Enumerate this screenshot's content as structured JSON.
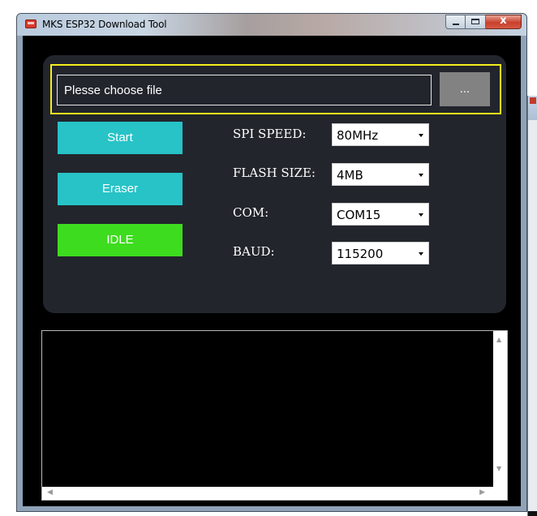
{
  "window": {
    "title": "MKS ESP32 Download Tool",
    "close_symbol": "x",
    "icon": "app-icon"
  },
  "file": {
    "value": "Plesse choose file",
    "browse_label": "..."
  },
  "buttons": {
    "start": "Start",
    "eraser": "Eraser",
    "status": "IDLE"
  },
  "settings": {
    "spi_speed_label": "SPI SPEED:",
    "spi_speed_value": "80MHz",
    "flash_size_label": "FLASH SIZE:",
    "flash_size_value": "4MB",
    "com_label": "COM:",
    "com_value": "COM15",
    "baud_label": "BAUD:",
    "baud_value": "115200"
  },
  "log": {
    "text": ""
  },
  "colors": {
    "highlight_frame": "#f5ee1c",
    "action_button": "#27c3c7",
    "status_idle": "#3ddc1e",
    "panel": "#22252c"
  }
}
